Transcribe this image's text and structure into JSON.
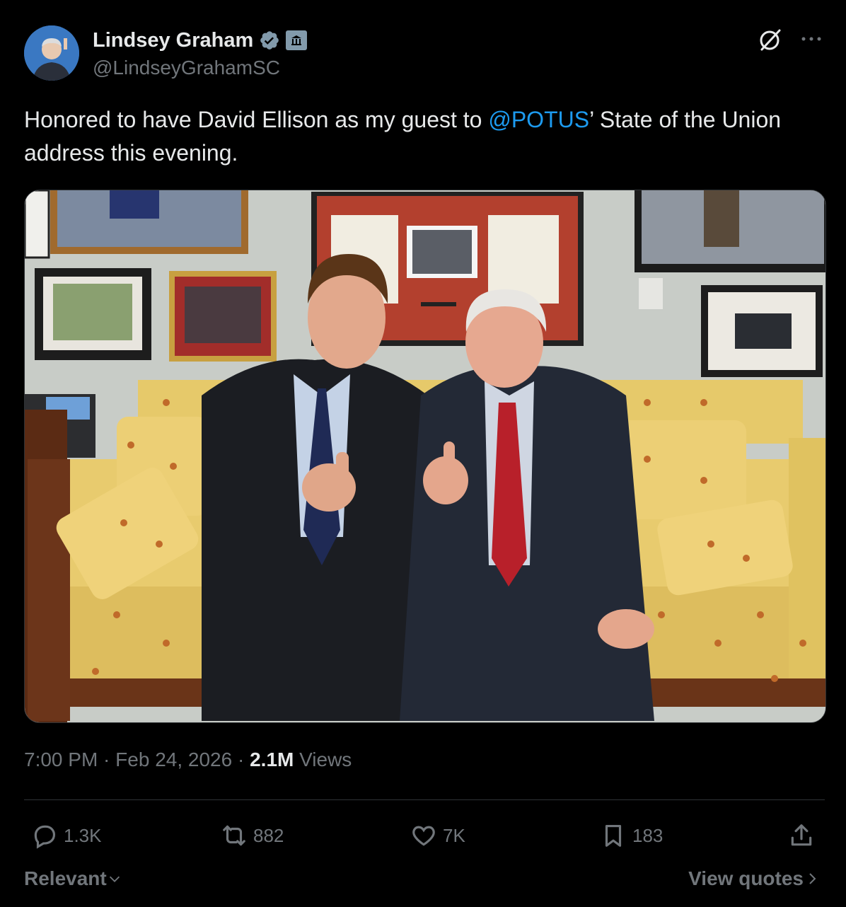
{
  "author": {
    "name": "Lindsey Graham",
    "handle": "@LindseyGrahamSC",
    "verified": true,
    "badge_icon": "government-building-icon"
  },
  "tweet": {
    "text_before": "Honored to have David Ellison as my guest to ",
    "mention": "@POTUS",
    "text_after": "’ State of the Union address this evening."
  },
  "meta": {
    "time": "7:00 PM",
    "separator1": " · ",
    "date": "Feb 24, 2026",
    "separator2": " · ",
    "views_count": "2.1M",
    "views_label": " Views"
  },
  "actions": {
    "replies": "1.3K",
    "reposts": "882",
    "likes": "7K",
    "bookmarks": "183"
  },
  "footer": {
    "sort_label": "Relevant",
    "view_quotes_label": "View quotes"
  },
  "colors": {
    "background": "#000000",
    "text_primary": "#e7e9ea",
    "text_secondary": "#71767b",
    "link": "#1d9bf0",
    "verified": "#829aab"
  }
}
